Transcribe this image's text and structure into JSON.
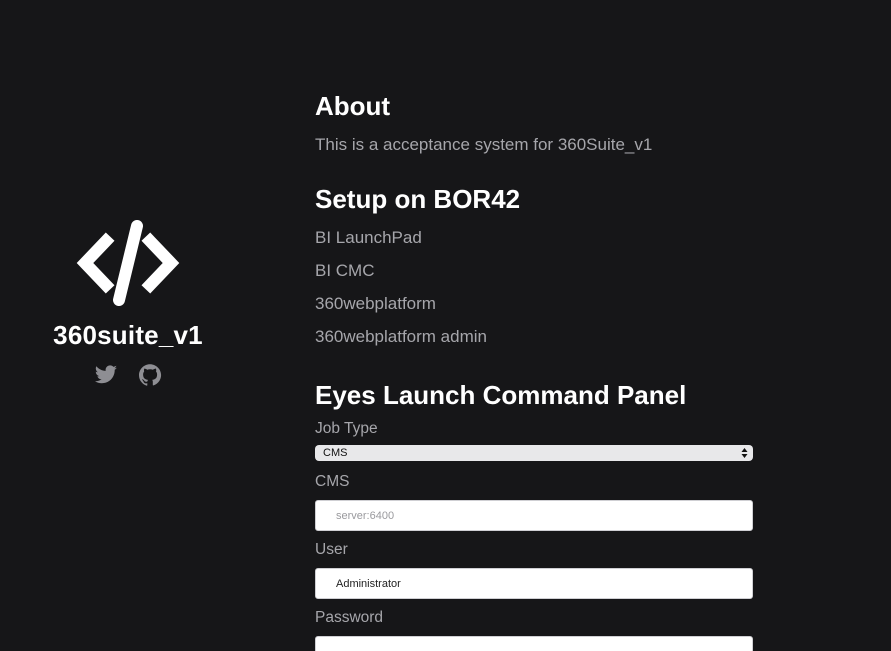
{
  "sidebar": {
    "site_name": "360suite_v1",
    "social": [
      {
        "icon": "twitter-icon"
      },
      {
        "icon": "github-icon"
      }
    ]
  },
  "about": {
    "title": "About",
    "text": "This is a acceptance system for 360Suite_v1"
  },
  "setup": {
    "title": "Setup on BOR42",
    "links": [
      "BI LaunchPad",
      "BI CMC",
      "360webplatform",
      "360webplatform admin"
    ]
  },
  "panel": {
    "title": "Eyes Launch Command Panel",
    "job_type_label": "Job Type",
    "job_type_value": "CMS",
    "cms_label": "CMS",
    "cms_placeholder": "server:6400",
    "user_label": "User",
    "user_value": "Administrator",
    "password_label": "Password"
  },
  "colors": {
    "background": "#161618",
    "heading": "#ffffff",
    "muted_text": "#a6a6ab"
  }
}
